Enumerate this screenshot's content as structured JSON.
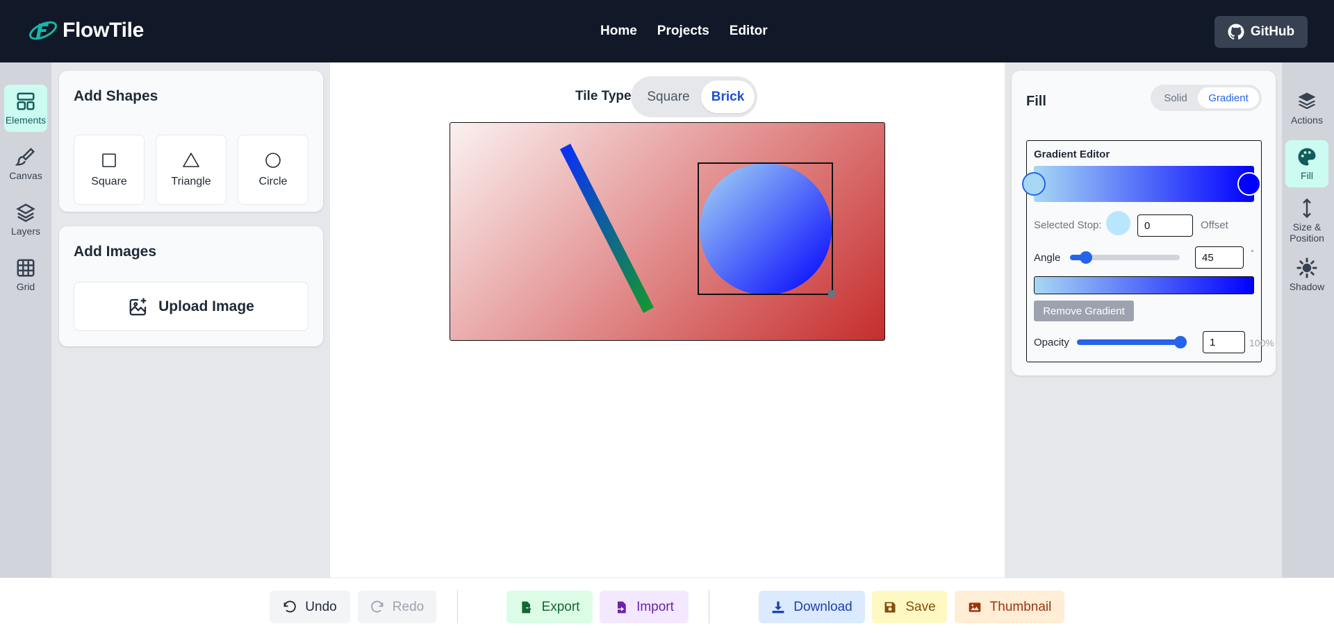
{
  "app": {
    "brand": "FlowTile",
    "nav": [
      "Home",
      "Projects",
      "Editor"
    ],
    "github_label": "GitHub"
  },
  "left_rail": {
    "items": [
      {
        "label": "Elements",
        "icon": "layout-icon",
        "active": true
      },
      {
        "label": "Canvas",
        "icon": "brush-icon",
        "active": false
      },
      {
        "label": "Layers",
        "icon": "layers-icon",
        "active": false
      },
      {
        "label": "Grid",
        "icon": "grid-icon",
        "active": false
      }
    ]
  },
  "add_shapes": {
    "title": "Add Shapes",
    "shapes": [
      "Square",
      "Triangle",
      "Circle"
    ]
  },
  "add_images": {
    "title": "Add Images",
    "upload_label": "Upload Image"
  },
  "tile_type": {
    "label": "Tile Type",
    "options": [
      "Square",
      "Brick"
    ],
    "selected": "Brick"
  },
  "fill_panel": {
    "title": "Fill",
    "modes": [
      "Solid",
      "Gradient"
    ],
    "selected_mode": "Gradient",
    "gradient_editor": {
      "title": "Gradient Editor",
      "stops": [
        {
          "color": "#a6d8f4",
          "offset": 0
        },
        {
          "color": "#0000ff",
          "offset": 100
        }
      ],
      "selected_stop_label": "Selected Stop:",
      "selected_stop_color": "#bae6fd",
      "offset_value": "0",
      "offset_label": "Offset",
      "angle_label": "Angle",
      "angle_value": "45",
      "angle_unit": "°",
      "remove_label": "Remove Gradient"
    },
    "opacity_label": "Opacity",
    "opacity_value": "1",
    "opacity_percent": "100%"
  },
  "right_rail": {
    "items": [
      {
        "label": "Actions",
        "icon": "stack-icon",
        "active": false
      },
      {
        "label": "Fill",
        "icon": "palette-icon",
        "active": true
      },
      {
        "label": "Size & Position",
        "icon": "resize-icon",
        "active": false
      },
      {
        "label": "Shadow",
        "icon": "sun-icon",
        "active": false
      }
    ]
  },
  "toolbar": {
    "undo": "Undo",
    "redo": "Redo",
    "export": "Export",
    "import": "Import",
    "download": "Download",
    "save": "Save",
    "thumbnail": "Thumbnail"
  },
  "colors": {
    "header_bg": "#111827",
    "accent_teal": "#ccfbf1",
    "accent_blue": "#2563eb",
    "canvas_gradient": [
      "#fbf1f1",
      "#c62d2d"
    ]
  }
}
